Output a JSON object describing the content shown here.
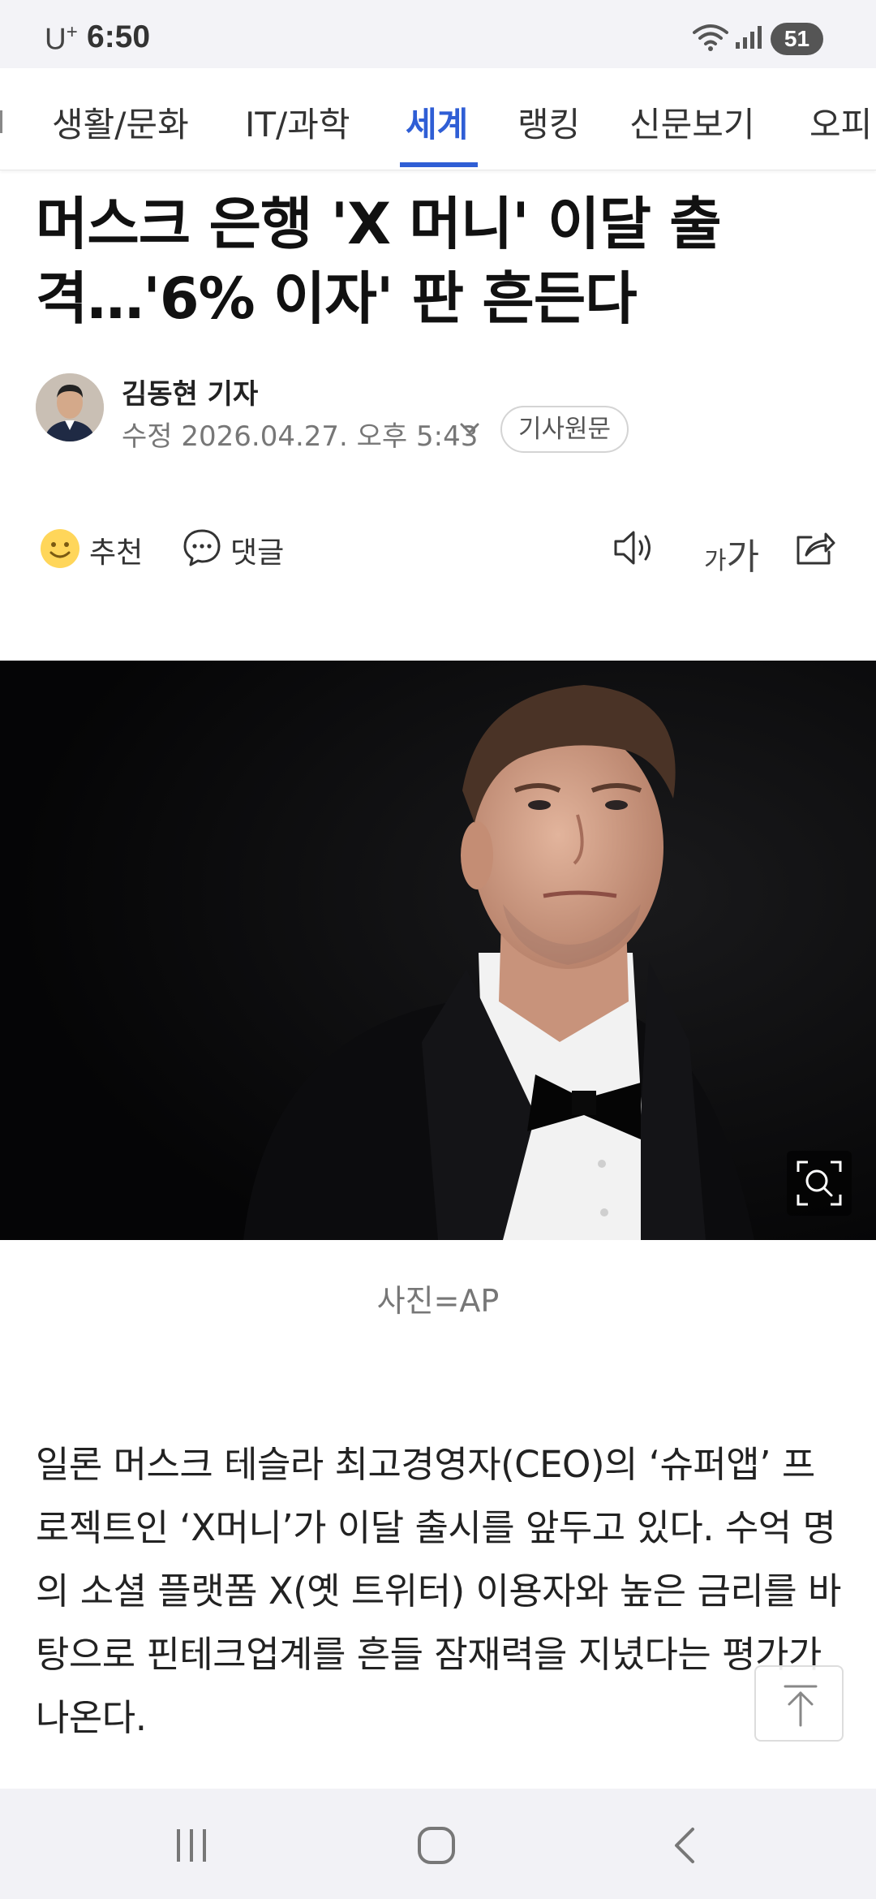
{
  "status_bar": {
    "carrier": "U",
    "carrier_sup": "+",
    "time": "6:50",
    "battery": "51"
  },
  "categories": [
    {
      "label": "생활/문화",
      "active": false
    },
    {
      "label": "IT/과학",
      "active": false
    },
    {
      "label": "세계",
      "active": true
    },
    {
      "label": "랭킹",
      "active": false
    },
    {
      "label": "신문보기",
      "active": false
    },
    {
      "label": "오피",
      "active": false
    }
  ],
  "article": {
    "headline": "머스크 은행 'X 머니' 이달 출격…'6% 이자' 판 흔든다",
    "reporter": "김동현 기자",
    "timestamp": "수정 2026.04.27. 오후 5:43",
    "original_button": "기사원문",
    "caption": "사진=AP",
    "body": "일론 머스크 테슬라 최고경영자(CEO)의 ‘슈퍼앱’ 프로젝트인 ‘X머니’가 이달 출시를 앞두고 있다. 수억 명의 소셜 플랫폼 X(옛 트위터) 이용자와 높은 금리를 바탕으로 핀테크업계를 흔들 잠재력을 지녔다는 평가가 나온다."
  },
  "actions": {
    "recommend": "추천",
    "comment": "댓글",
    "font_small": "가",
    "font_big": "가"
  },
  "icons": {
    "wifi": "wifi-icon",
    "signal": "signal-icon",
    "recommend": "smiley-icon",
    "comment": "speech-bubble-icon",
    "speaker": "speaker-icon",
    "share": "share-icon",
    "zoom": "zoom-icon",
    "top": "scroll-top-icon"
  },
  "colors": {
    "accent": "#2f5ed5",
    "status_bar_bg": "#f3f3f7"
  }
}
